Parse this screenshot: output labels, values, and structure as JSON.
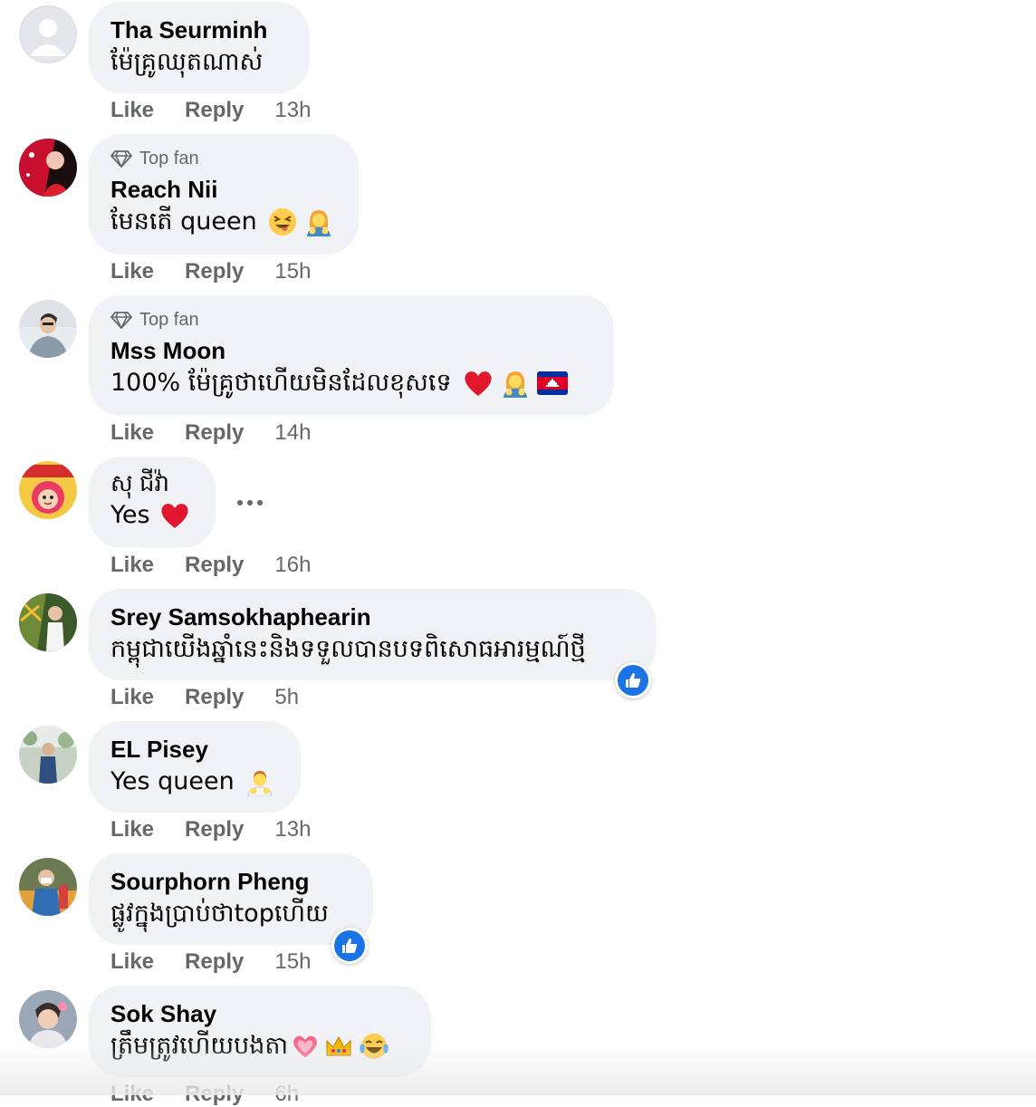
{
  "action_labels": {
    "like": "Like",
    "reply": "Reply"
  },
  "comments": [
    {
      "author": "Tha Seurminh",
      "text": "ម៉ែគ្រូឈុតណាស់",
      "time": "13h"
    },
    {
      "badge": "Top fan",
      "author": "Reach Nii",
      "text": "មែនតើ queen",
      "emojis": [
        "squinting-tongue-emoji",
        "woman-gesturing-emoji"
      ],
      "time": "15h"
    },
    {
      "badge": "Top fan",
      "author": "Mss Moon",
      "text": "100% ម៉ែគ្រូថាហើយមិនដែលខុសទេ",
      "emojis": [
        "red-heart-emoji",
        "woman-gesturing-emoji",
        "cambodia-flag-emoji"
      ],
      "time": "14h"
    },
    {
      "author": "សុ ជីវ៉ា",
      "text": "Yes",
      "emojis": [
        "red-heart-emoji"
      ],
      "time": "16h",
      "has_more_menu": true
    },
    {
      "author": "Srey Samsokhaphearin",
      "text": "កម្ពុជាយើងឆ្នាំនេះនិងទទួលបានបទពិសោធអារម្មណ៍ថ្មី",
      "time": "5h",
      "reaction": "like"
    },
    {
      "author": "EL Pisey",
      "text": "Yes queen",
      "emojis": [
        "man-gesturing-emoji"
      ],
      "time": "13h"
    },
    {
      "author": "Sourphorn Pheng",
      "text": "ផ្លូវក្នុងប្រាប់ថាtopហើយ",
      "time": "15h",
      "reaction": "like"
    },
    {
      "author": "Sok Shay",
      "text": "ត្រឹមត្រូវហើយបងតា",
      "emojis": [
        "pink-heart-emoji",
        "crown-emoji",
        "tears-of-joy-emoji"
      ],
      "time": "6h"
    }
  ],
  "colors": {
    "bubble": "#f0f2f5",
    "meta": "#65676b",
    "like_blue": "#1b74e4"
  }
}
